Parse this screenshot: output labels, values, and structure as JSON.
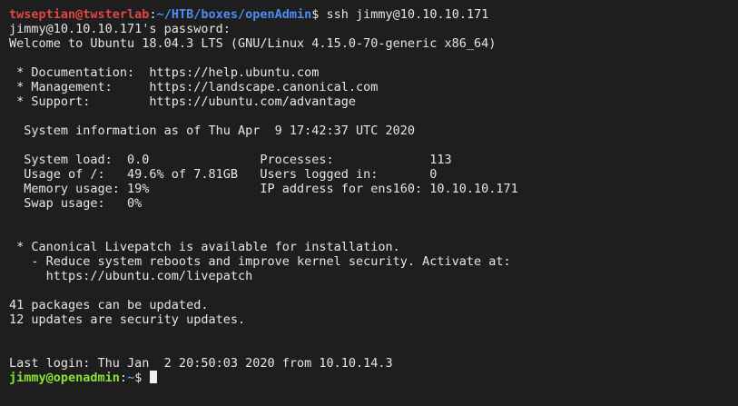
{
  "prompt1": {
    "user_host": "twseptian@twsterlab",
    "sep": ":",
    "path": "~/HTB/boxes/openAdmin",
    "dollar": "$ ",
    "command": "ssh jimmy@10.10.10.171"
  },
  "output": [
    "jimmy@10.10.10.171's password:",
    "Welcome to Ubuntu 18.04.3 LTS (GNU/Linux 4.15.0-70-generic x86_64)",
    "",
    " * Documentation:  https://help.ubuntu.com",
    " * Management:     https://landscape.canonical.com",
    " * Support:        https://ubuntu.com/advantage",
    "",
    "  System information as of Thu Apr  9 17:42:37 UTC 2020",
    "",
    "  System load:  0.0               Processes:             113",
    "  Usage of /:   49.6% of 7.81GB   Users logged in:       0",
    "  Memory usage: 19%               IP address for ens160: 10.10.10.171",
    "  Swap usage:   0%",
    "",
    "",
    " * Canonical Livepatch is available for installation.",
    "   - Reduce system reboots and improve kernel security. Activate at:",
    "     https://ubuntu.com/livepatch",
    "",
    "41 packages can be updated.",
    "12 updates are security updates.",
    "",
    "",
    "Last login: Thu Jan  2 20:50:03 2020 from 10.10.14.3"
  ],
  "prompt2": {
    "user_host": "jimmy@openadmin",
    "sep": ":",
    "path": "~",
    "dollar": "$ "
  }
}
